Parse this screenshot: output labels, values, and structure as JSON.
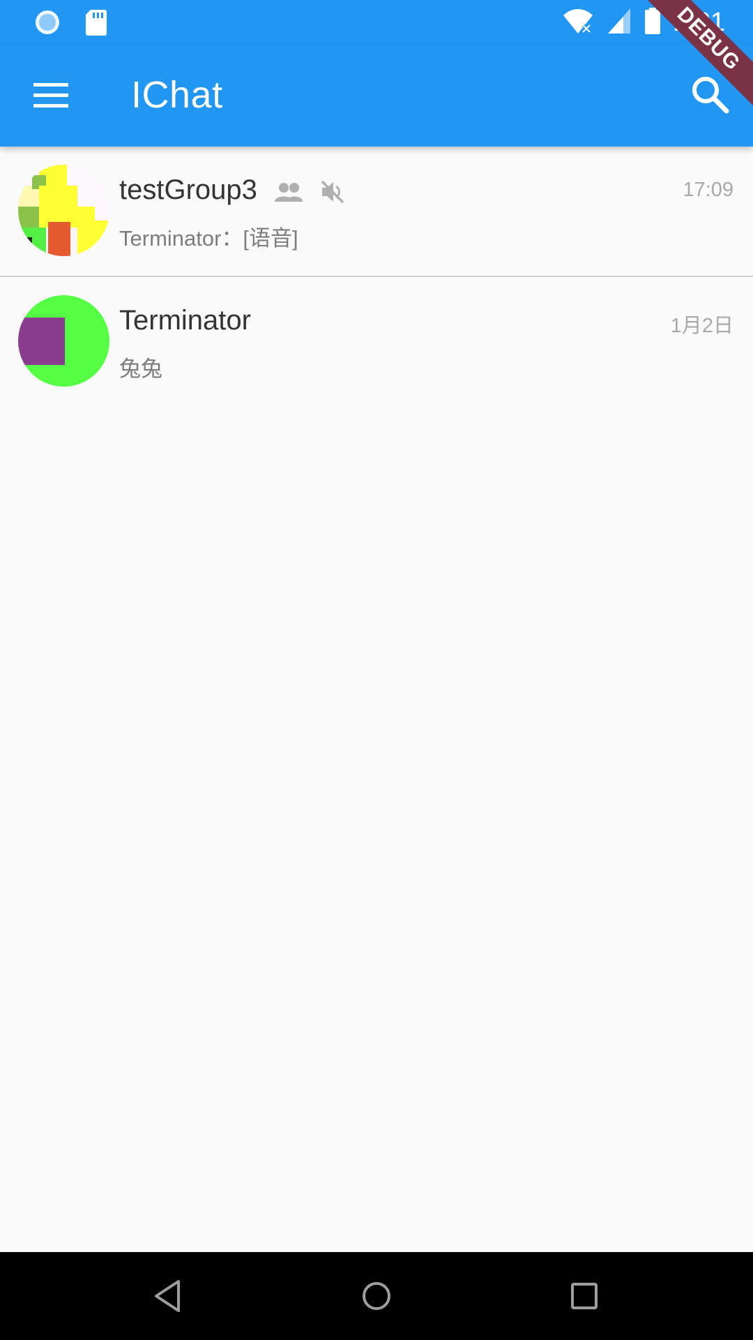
{
  "status_bar": {
    "time": "2:21",
    "icons": [
      "sync-icon",
      "sd-card-icon",
      "wifi-off-icon",
      "cell-signal-icon",
      "battery-icon"
    ]
  },
  "app_bar": {
    "title": "IChat",
    "menu_icon": "menu-icon",
    "search_icon": "search-icon",
    "color": "#2196f3"
  },
  "debug_banner": "DEBUG",
  "conversations": [
    {
      "name": "testGroup3",
      "preview": "Terminator：[语音]",
      "time": "17:09",
      "icons": [
        "group-icon",
        "muted-icon"
      ]
    },
    {
      "name": "Terminator",
      "preview": "兔兔",
      "time": "1月2日",
      "icons": []
    }
  ],
  "nav_bar": {
    "buttons": [
      "back-icon",
      "home-icon",
      "recents-icon"
    ]
  }
}
